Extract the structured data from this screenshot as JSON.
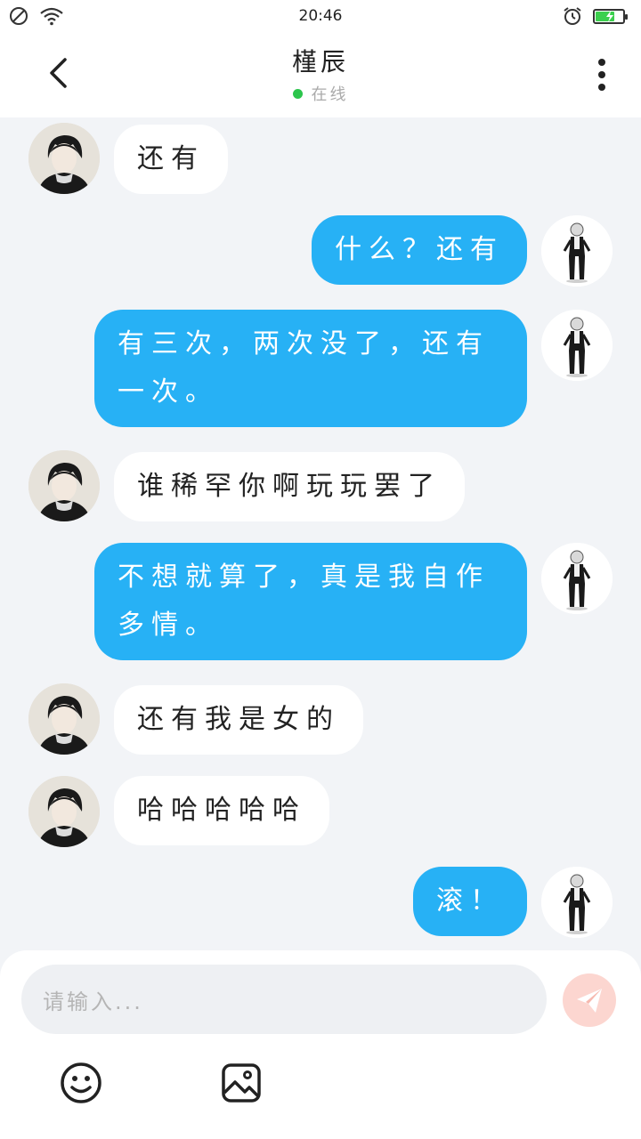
{
  "status_bar": {
    "time": "20:46",
    "battery_level": 0.7,
    "battery_color": "#3ccf4e",
    "icons": [
      "no-sim-icon",
      "wifi-icon",
      "alarm-icon",
      "battery-charging-icon"
    ]
  },
  "header": {
    "contact_name": "槿辰",
    "presence": "在线",
    "presence_color": "#2cc54c",
    "icons": [
      "back-arrow-icon",
      "more-vertical-icon"
    ]
  },
  "messages": [
    {
      "side": "in",
      "text": "还有"
    },
    {
      "side": "out",
      "text": "什么？还有"
    },
    {
      "side": "out",
      "lines": [
        "有三次，两次没了，还有",
        "一次。"
      ]
    },
    {
      "side": "in",
      "text": "谁稀罕你啊玩玩罢了"
    },
    {
      "side": "out",
      "lines": [
        "不想就算了，真是我自作",
        "多情。"
      ]
    },
    {
      "side": "in",
      "text": "还有我是女的"
    },
    {
      "side": "in",
      "text": "哈哈哈哈哈"
    },
    {
      "side": "out",
      "text": "滚！"
    }
  ],
  "colors": {
    "outgoing_bubble": "#27b1f5",
    "incoming_bubble": "#ffffff",
    "chat_background": "#f2f4f7"
  },
  "composer": {
    "placeholder": "请输入...",
    "icons": [
      "send-paper-plane-icon",
      "emoji-icon",
      "image-icon"
    ]
  }
}
